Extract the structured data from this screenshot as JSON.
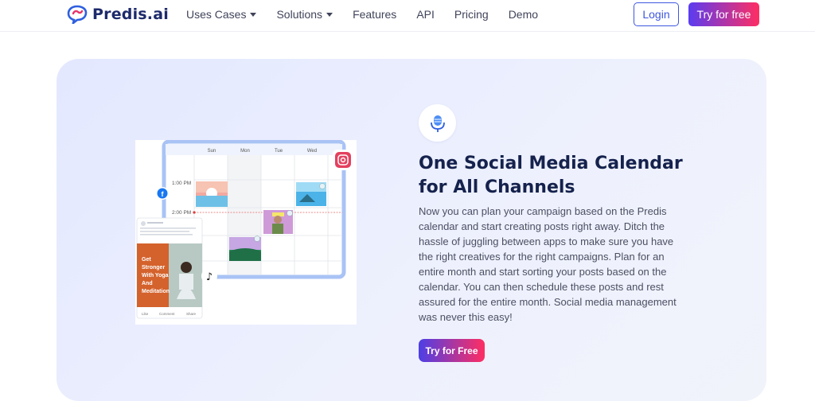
{
  "brand": {
    "name": "Predis.ai"
  },
  "nav": {
    "items": [
      {
        "label": "Uses Cases",
        "dropdown": true
      },
      {
        "label": "Solutions",
        "dropdown": true
      },
      {
        "label": "Features",
        "dropdown": false
      },
      {
        "label": "API",
        "dropdown": false
      },
      {
        "label": "Pricing",
        "dropdown": false
      },
      {
        "label": "Demo",
        "dropdown": false
      }
    ],
    "login_label": "Login",
    "try_label": "Try for free"
  },
  "hero": {
    "title": "One Social Media Calendar for All Channels",
    "description": "Now you can plan your campaign based on the Predis calendar and start creating posts right away. Ditch the hassle of juggling between apps to make sure you have the right creatives for the right campaigns. Plan for an entire month and start sorting your posts based on the calendar. You can then schedule these posts and rest assured for the entire month. Social media management was never this easy!",
    "cta_label": "Try for Free"
  },
  "illustration": {
    "days": [
      "Sun",
      "Mon",
      "Tue",
      "Wed"
    ],
    "times": [
      "1:00 PM",
      "2:00 PM"
    ],
    "post_text": "Get Stronger With Yoga And Meditation",
    "post_actions": [
      "Like",
      "Comment",
      "Share"
    ]
  },
  "colors": {
    "brand_dark": "#1d2a6b",
    "accent_blue": "#3f57e0",
    "gradient_start": "#5a3cf0",
    "gradient_end": "#ff2e62"
  }
}
